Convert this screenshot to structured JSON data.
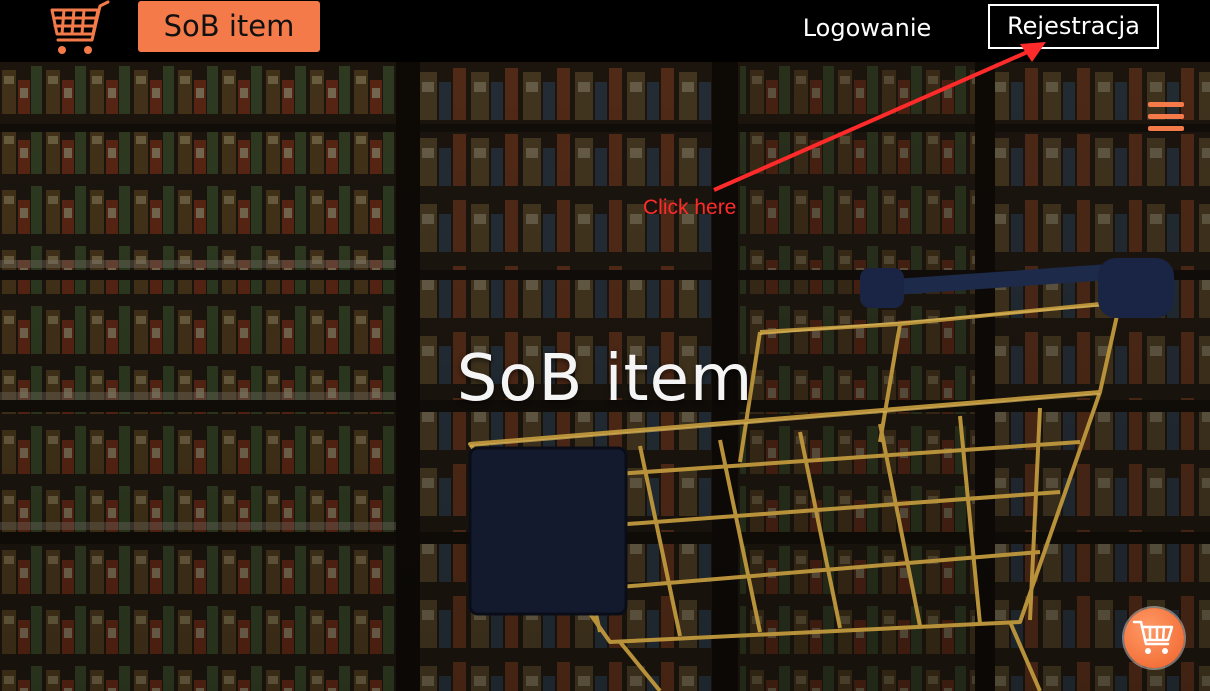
{
  "header": {
    "logo_icon": "shopping-cart-icon",
    "brand_label": "SoB item",
    "login_label": "Logowanie",
    "register_label": "Rejestracja"
  },
  "hero": {
    "title": "SoB item",
    "menu_icon": "hamburger-menu-icon",
    "cart_button_icon": "shopping-cart-icon"
  },
  "annotation": {
    "text": "Click here",
    "color": "#ff2a2a"
  },
  "colors": {
    "accent": "#f47a4a",
    "topbar": "#000000",
    "text_light": "#ffffff"
  }
}
